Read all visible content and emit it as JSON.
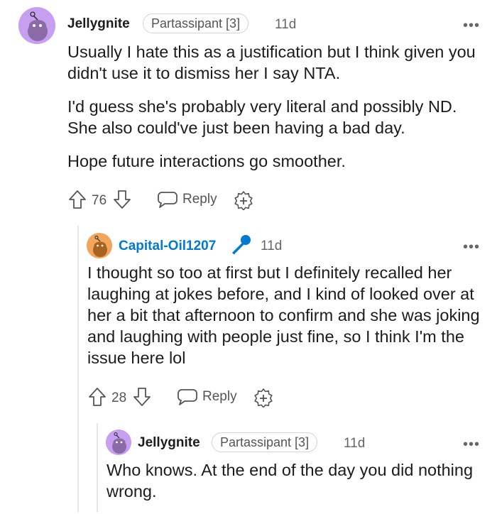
{
  "comments": [
    {
      "username": "Jellygnite",
      "flair": "Partassipant [3]",
      "time": "11d",
      "menu": "•••",
      "paragraphs": [
        "Usually I hate this as a justification but I think given you didn't use it to dismiss her I say NTA.",
        "I'd guess she's probably very literal and possibly ND. She also could've just been having a bad day.",
        "Hope future interactions go smoother."
      ],
      "votes": "76",
      "reply_label": "Reply",
      "avatar_color": "#c79ff0"
    },
    {
      "username": "Capital-Oil1207",
      "time": "11d",
      "menu": "•••",
      "paragraphs": [
        "I thought so too at first but I definitely recalled her laughing at jokes before, and I kind of looked over at her a bit that afternoon to confirm and she was joking and laughing with people just fine, so I think I'm the issue here lol"
      ],
      "votes": "28",
      "reply_label": "Reply",
      "avatar_color": "#f3a55c",
      "username_color": "#0079d3"
    },
    {
      "username": "Jellygnite",
      "flair": "Partassipant [3]",
      "time": "11d",
      "menu": "•••",
      "paragraphs": [
        "Who knows. At the end of the day you did nothing wrong."
      ],
      "avatar_color": "#c79ff0"
    }
  ]
}
